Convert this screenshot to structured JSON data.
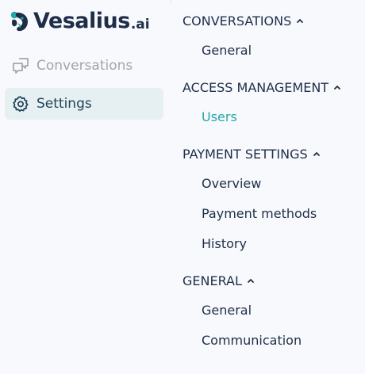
{
  "brand": {
    "name": "Vesalius",
    "suffix": ".ai"
  },
  "colors": {
    "brand_teal": "#22a8a8",
    "brand_dark": "#1e2e48",
    "muted": "#a0a5ad",
    "active_bg": "#e6f0f3"
  },
  "sidebar": {
    "items": [
      {
        "label": "Conversations",
        "icon": "chat-bubbles-icon",
        "active": false
      },
      {
        "label": "Settings",
        "icon": "gear-icon",
        "active": true
      }
    ]
  },
  "settings_menu": {
    "sections": [
      {
        "title": "CONVERSATIONS",
        "expanded": true,
        "items": [
          {
            "label": "General",
            "active": false
          }
        ]
      },
      {
        "title": "ACCESS MANAGEMENT",
        "expanded": true,
        "items": [
          {
            "label": "Users",
            "active": true
          }
        ]
      },
      {
        "title": "PAYMENT SETTINGS",
        "expanded": true,
        "items": [
          {
            "label": "Overview",
            "active": false
          },
          {
            "label": "Payment methods",
            "active": false
          },
          {
            "label": "History",
            "active": false
          }
        ]
      },
      {
        "title": "GENERAL",
        "expanded": true,
        "items": [
          {
            "label": "General",
            "active": false
          },
          {
            "label": "Communication",
            "active": false
          }
        ]
      }
    ]
  }
}
